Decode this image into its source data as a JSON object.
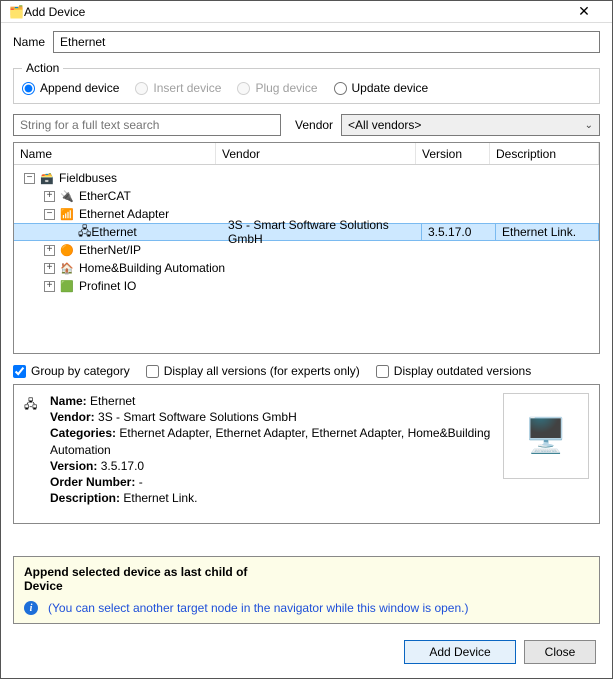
{
  "window_title": "Add Device",
  "name_field": {
    "label": "Name",
    "value": "Ethernet"
  },
  "action_group": {
    "legend": "Action",
    "options": [
      {
        "label": "Append device",
        "enabled": true,
        "checked": true
      },
      {
        "label": "Insert device",
        "enabled": false,
        "checked": false
      },
      {
        "label": "Plug device",
        "enabled": false,
        "checked": false
      },
      {
        "label": "Update device",
        "enabled": true,
        "checked": false
      }
    ]
  },
  "search": {
    "placeholder": "String for a full text search"
  },
  "vendor": {
    "label": "Vendor",
    "selected": "<All vendors>"
  },
  "columns": {
    "name": "Name",
    "vendor": "Vendor",
    "version": "Version",
    "description": "Description"
  },
  "tree": {
    "fieldbuses": "Fieldbuses",
    "ethercat": "EtherCAT",
    "ethernet_adapter": "Ethernet Adapter",
    "ethernet": "Ethernet",
    "ethernetip": "EtherNet/IP",
    "homebuilding": "Home&Building Automation",
    "profinet": "Profinet IO"
  },
  "selected": {
    "name": "Ethernet",
    "vendor": "3S - Smart Software Solutions GmbH",
    "version": "3.5.17.0",
    "description": "Ethernet Link."
  },
  "checks": {
    "group_by_category": {
      "label": "Group by category",
      "checked": true
    },
    "display_all_versions": {
      "label": "Display all versions (for experts only)",
      "checked": false
    },
    "display_outdated": {
      "label": "Display outdated versions",
      "checked": false
    }
  },
  "details": {
    "icon_name": "device-icon",
    "labels": {
      "name": "Name:",
      "vendor": "Vendor:",
      "categories": "Categories:",
      "version": "Version:",
      "order_number": "Order Number:",
      "description": "Description:"
    },
    "name": "Ethernet",
    "vendor": "3S - Smart Software Solutions GmbH",
    "categories": "Ethernet Adapter, Ethernet Adapter, Ethernet Adapter, Home&Building Automation",
    "version": "3.5.17.0",
    "order_number": "-",
    "description": "Ethernet Link."
  },
  "hint": {
    "line1": "Append selected device as last child of",
    "line2": "Device",
    "info": "(You can select another target node in the navigator while this window is open.)"
  },
  "buttons": {
    "add": "Add Device",
    "close": "Close"
  }
}
